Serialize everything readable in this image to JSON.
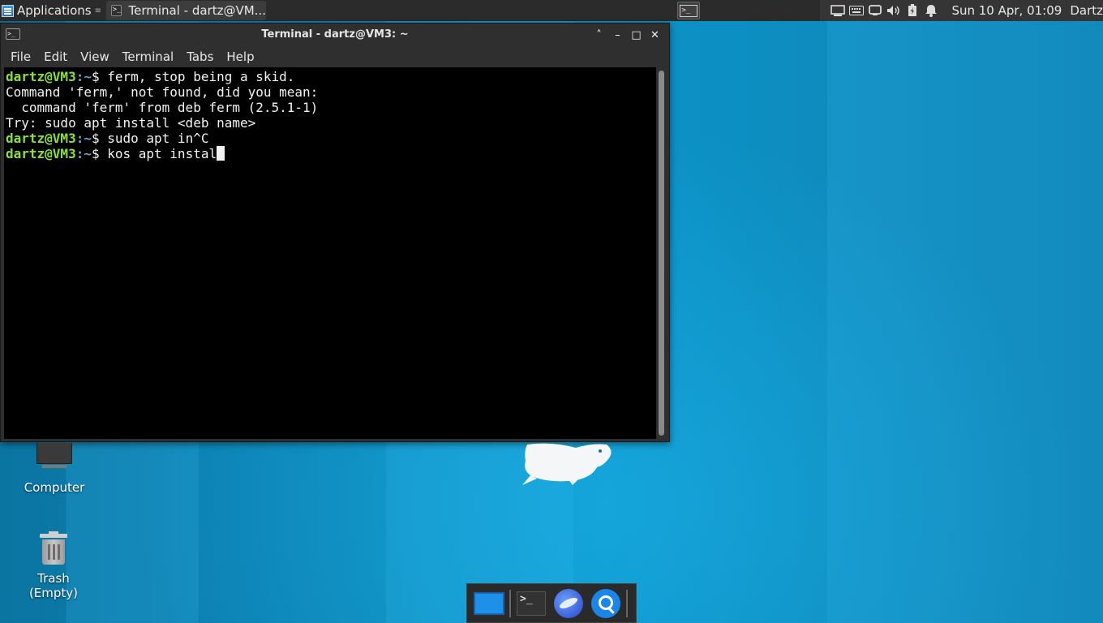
{
  "top_panel": {
    "apps_label": "Applications",
    "separator": "≡",
    "taskbar_window_title": "Terminal - dartz@VM...",
    "clock": "Sun 10 Apr, 01:09",
    "user": "Dartz",
    "launcher_glyph": ">_",
    "tray_icons": [
      "network-icon",
      "keyboard-icon",
      "display-icon",
      "volume-icon",
      "battery-icon",
      "notifications-icon"
    ]
  },
  "window": {
    "title": "Terminal - dartz@VM3: ~",
    "icon_glyph": ">_",
    "controls": {
      "shade": "˄",
      "minimize": "–",
      "maximize": "□",
      "close": "✕"
    },
    "menu": [
      "File",
      "Edit",
      "View",
      "Terminal",
      "Tabs",
      "Help"
    ]
  },
  "terminal": {
    "prompt_user": "dartz@VM3",
    "prompt_path": ":~",
    "prompt_symbol": "$ ",
    "lines": [
      {
        "prompt": true,
        "text": "ferm, stop being a skid."
      },
      {
        "prompt": false,
        "text": "Command 'ferm,' not found, did you mean:"
      },
      {
        "prompt": false,
        "text": "  command 'ferm' from deb ferm (2.5.1-1)"
      },
      {
        "prompt": false,
        "text": "Try: sudo apt install <deb name>"
      },
      {
        "prompt": true,
        "text": "sudo apt in^C"
      },
      {
        "prompt": true,
        "text": "kos apt instal",
        "cursor": true
      }
    ]
  },
  "desktop": {
    "computer_label": "Computer",
    "trash_label": "Trash\n(Empty)"
  },
  "dock": {
    "items": [
      "show-desktop-icon",
      "terminal-icon",
      "web-browser-icon",
      "app-finder-icon"
    ],
    "terminal_glyph": ">_"
  },
  "colors": {
    "prompt_user": "#8ae234",
    "prompt_path": "#729fcf",
    "terminal_bg": "#000000",
    "panel_bg": "#2b2b2b"
  }
}
